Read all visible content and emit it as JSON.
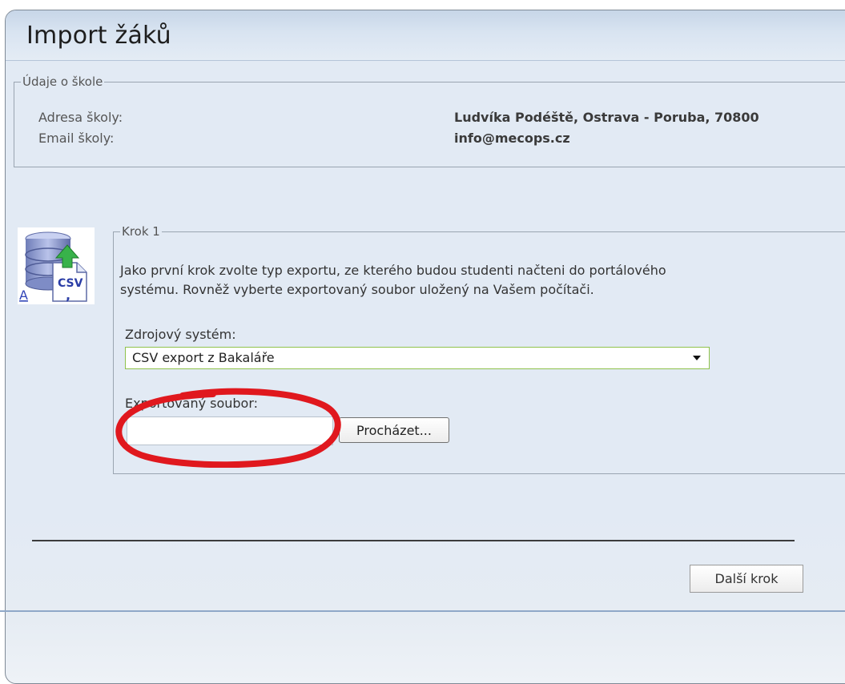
{
  "window": {
    "title": "Import žáků"
  },
  "school": {
    "legend": "Údaje o škole",
    "address_label": "Adresa školy:",
    "address_value": "Ludvíka Podéště, Ostrava - Poruba, 70800",
    "email_label": "Email školy:",
    "email_value": "info@mecops.cz"
  },
  "step1": {
    "legend": "Krok 1",
    "description_line1": "Jako první krok zvolte typ exportu, ze kterého budou studenti načteni do portálového",
    "description_line2": "systému. Rovněž vyberte exportovaný soubor uložený na Vašem počítači.",
    "source_label": "Zdrojový systém:",
    "source_value": "CSV export z Bakaláře",
    "file_label": "Exportovaný soubor:",
    "file_value": "",
    "browse_label": "Procházet..."
  },
  "icon": {
    "name": "csv-import-icon",
    "badge": "CSV",
    "letter": "A"
  },
  "footer": {
    "next_label": "Další krok"
  },
  "colors": {
    "background": "#e2eaf4",
    "select_border": "#8fc24b",
    "annotation": "#e0181e",
    "bottom_line": "#8fa8c8"
  }
}
